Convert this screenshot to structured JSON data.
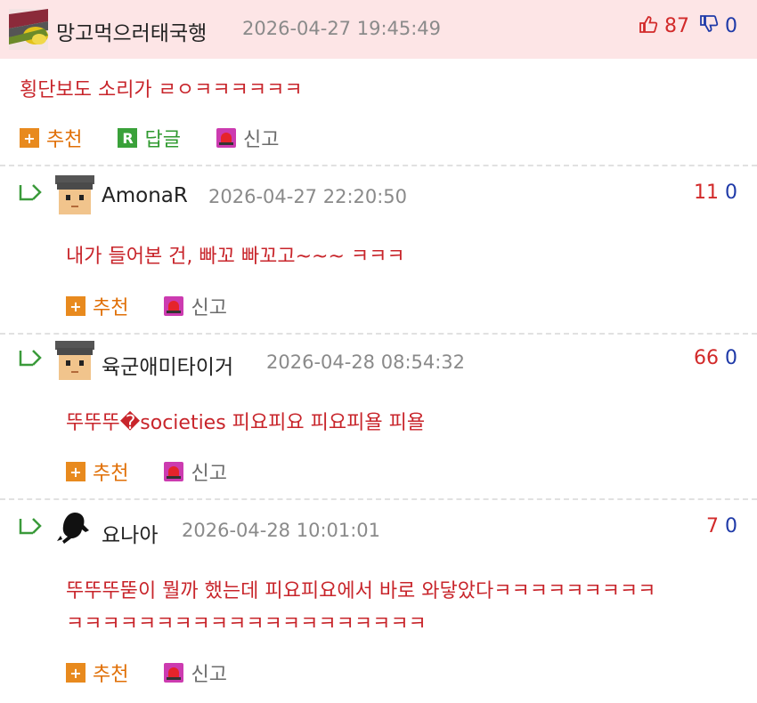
{
  "main": {
    "nickname": "망고먹으러태국행",
    "date": "2026-04-27 19:45:49",
    "up_count": "87",
    "down_count": "0",
    "text": "횡단보도 소리가 ㄹㅇㅋㅋㅋㅋㅋㅋ",
    "actions": {
      "recommend": "추천",
      "reply": "답글",
      "report": "신고"
    },
    "reply_badge": "R"
  },
  "replies": [
    {
      "nickname": "AmonaR",
      "date": "2026-04-27 22:20:50",
      "up_count": "11",
      "down_count": "0",
      "lines": [
        "내가 들어본 건, 빠꼬 빠꼬고~~~ ㅋㅋㅋ"
      ],
      "actions": {
        "recommend": "추천",
        "report": "신고"
      }
    },
    {
      "nickname": "육군애미타이거",
      "date": "2026-04-28 08:54:32",
      "up_count": "66",
      "down_count": "0",
      "lines": [
        "뚜뚜뚜�societies 피요피요 피요피욜 피욜"
      ],
      "actions": {
        "recommend": "추천",
        "report": "신고"
      }
    },
    {
      "nickname": "요나아",
      "date": "2026-04-28 10:01:01",
      "up_count": "7",
      "down_count": "0",
      "lines": [
        "뚜뚜뚜뚣이 뭘까 했는데 피요피요에서 바로 와닿았다ㅋㅋㅋㅋㅋㅋㅋㅋㅋ",
        "ㅋㅋㅋㅋㅋㅋㅋㅋㅋㅋㅋㅋㅋㅋㅋㅋㅋㅋㅋㅋ"
      ],
      "actions": {
        "recommend": "추천",
        "report": "신고"
      }
    }
  ],
  "colors": {
    "header_bg": "#fde5e6",
    "body_text": "#c8252b",
    "up": "#d22a2a",
    "down": "#1f3aa8",
    "recommend": "#e06f06",
    "reply": "#2f9a2f"
  },
  "icons": {
    "main_avatar": "mango-avatar-icon",
    "reply_avatar": "pixel-face-avatar-icon",
    "reply_arrow": "reply-arrow-icon",
    "thumb_up": "thumb-up-icon",
    "thumb_down": "thumb-down-icon",
    "recommend": "plus-icon",
    "reply": "reply-r-icon",
    "report": "siren-icon"
  }
}
